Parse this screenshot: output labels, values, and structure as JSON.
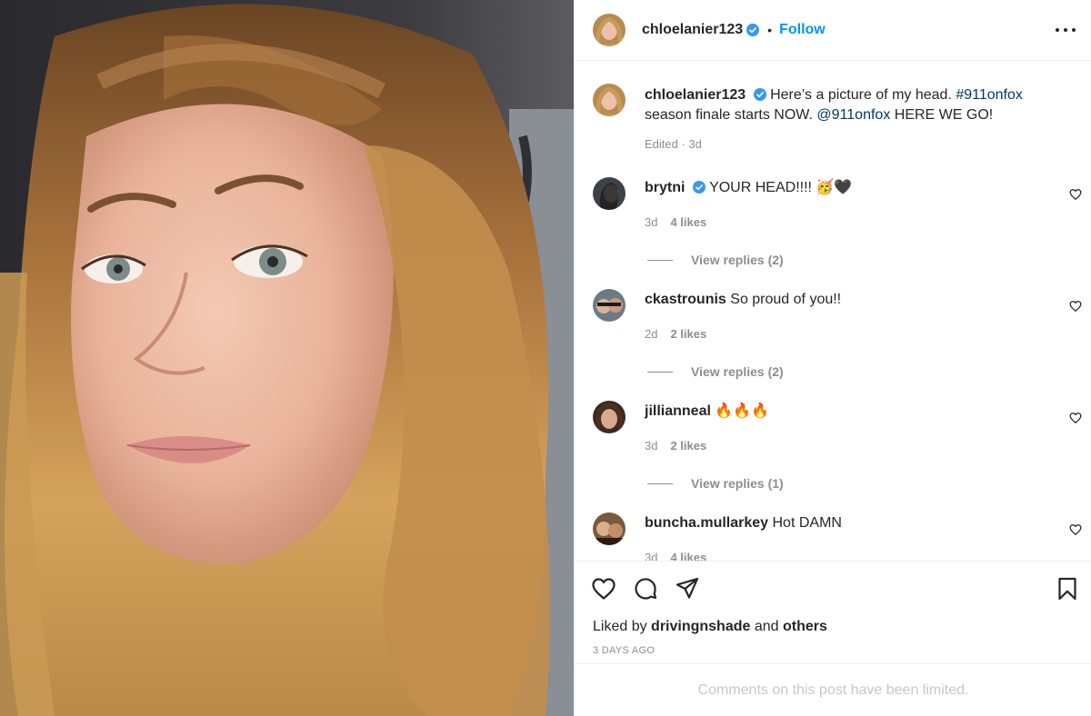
{
  "post": {
    "author": "chloelanier123",
    "follow_label": "Follow",
    "separator": "•",
    "caption": {
      "username": "chloelanier123",
      "text_1": "Here’s a picture of my head.",
      "hashtag": "#911onfox",
      "text_2": "season finale starts NOW.",
      "mention": "@911onfox",
      "text_3": "HERE WE GO!",
      "meta": "Edited · 3d"
    }
  },
  "comments": [
    {
      "username": "brytni",
      "verified": true,
      "text": "YOUR HEAD!!!! 🥳🖤",
      "age": "3d",
      "likes": "4 likes",
      "replies": "View replies (2)"
    },
    {
      "username": "ckastrounis",
      "verified": false,
      "text": "So proud of you!!",
      "age": "2d",
      "likes": "2 likes",
      "replies": "View replies (2)"
    },
    {
      "username": "jillianneal",
      "verified": false,
      "text": "🔥🔥🔥",
      "age": "3d",
      "likes": "2 likes",
      "replies": "View replies (1)"
    },
    {
      "username": "buncha.mullarkey",
      "verified": false,
      "text": "Hot DAMN",
      "age": "3d",
      "likes": "4 likes",
      "replies": ""
    }
  ],
  "footer": {
    "liked_by_prefix": "Liked by",
    "liked_by_user": "drivingnshade",
    "liked_by_and": "and",
    "liked_by_others": "others",
    "time_ago": "3 DAYS AGO",
    "limited_notice": "Comments on this post have been limited."
  },
  "icons": {
    "verified": "verified-badge-icon",
    "like": "heart-icon",
    "comment": "comment-bubble-icon",
    "share": "paper-plane-icon",
    "save": "bookmark-icon",
    "more": "ellipsis-icon"
  },
  "colors": {
    "follow_blue": "#0095f6",
    "link_blue": "#00376b",
    "muted": "#8e8e8e",
    "border": "#efefef"
  }
}
